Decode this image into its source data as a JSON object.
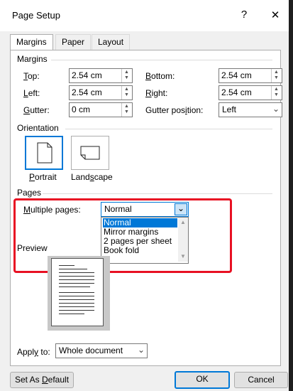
{
  "window": {
    "title": "Page Setup",
    "help": "?",
    "close": "✕"
  },
  "tabs": [
    {
      "label": "Margins"
    },
    {
      "label": "Paper"
    },
    {
      "label": "Layout"
    }
  ],
  "margins": {
    "section": "Margins",
    "top": {
      "pre": "",
      "u": "T",
      "post": "op:",
      "value": "2.54 cm"
    },
    "bottom": {
      "pre": "",
      "u": "B",
      "post": "ottom:",
      "value": "2.54 cm"
    },
    "left": {
      "pre": "",
      "u": "L",
      "post": "eft:",
      "value": "2.54 cm"
    },
    "right": {
      "pre": "",
      "u": "R",
      "post": "ight:",
      "value": "2.54 cm"
    },
    "gutter": {
      "pre": "",
      "u": "G",
      "post": "utter:",
      "value": "0 cm"
    },
    "gutter_position": {
      "pre": "Gutter pos",
      "u": "i",
      "post": "tion:",
      "value": "Left"
    }
  },
  "orientation": {
    "section": "Orientation",
    "portrait": {
      "u": "P",
      "post": "ortrait"
    },
    "landscape": {
      "pre": "Land",
      "u": "s",
      "post": "cape"
    }
  },
  "pages": {
    "section": "Pages",
    "multiple": {
      "u": "M",
      "post": "ultiple pages:",
      "value": "Normal"
    },
    "options": [
      "Normal",
      "Mirror margins",
      "2 pages per sheet",
      "Book fold"
    ]
  },
  "preview": {
    "section": "Preview"
  },
  "apply_to": {
    "pre": "Appl",
    "u": "y",
    "post": " to:",
    "value": "Whole document"
  },
  "buttons": {
    "default": {
      "pre": "Set As ",
      "u": "D",
      "post": "efault"
    },
    "ok": "OK",
    "cancel": "Cancel"
  },
  "colors": {
    "accent": "#0078d7",
    "highlight": "#e81123"
  }
}
